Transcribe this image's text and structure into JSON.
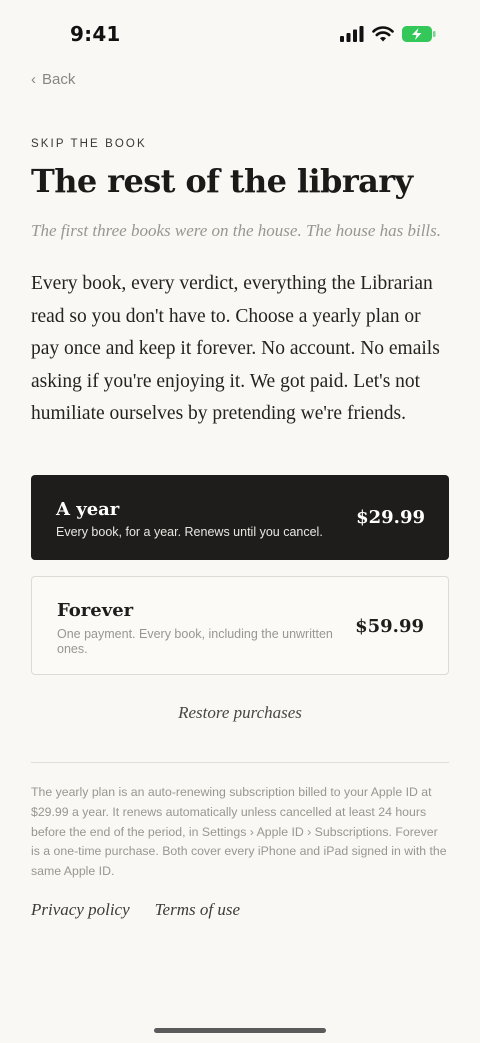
{
  "status_bar": {
    "time": "9:41",
    "icons": [
      "cellular-signal-icon",
      "wifi-icon",
      "battery-charging-icon"
    ],
    "battery_color": "#34c759"
  },
  "nav": {
    "back_label": "Back"
  },
  "header": {
    "eyebrow": "SKIP THE BOOK",
    "title": "The rest of the library",
    "subtitle": "The first three books were on the house. The house has bills."
  },
  "body": {
    "paragraph": "Every book, every verdict, everything the Librarian read so you don't have to. Choose a yearly plan or pay once and keep it forever. No account. No emails asking if you're enjoying it. We got paid. Let's not humiliate ourselves by pretending we're friends."
  },
  "plans": [
    {
      "name": "A year",
      "description": "Every book, for a year. Renews until you cancel.",
      "price": "$29.99",
      "selected": true
    },
    {
      "name": "Forever",
      "description": "One payment. Every book, including the unwritten ones.",
      "price": "$59.99",
      "selected": false
    }
  ],
  "actions": {
    "restore_label": "Restore purchases"
  },
  "legal": {
    "text": "The yearly plan is an auto-renewing subscription billed to your Apple ID at $29.99 a year. It renews automatically unless cancelled at least 24 hours before the end of the period, in Settings › Apple ID › Subscriptions. Forever is a one-time purchase. Both cover every iPhone and iPad signed in with the same Apple ID."
  },
  "footer": {
    "privacy_label": "Privacy policy",
    "terms_label": "Terms of use"
  },
  "colors": {
    "background": "#f9f8f4",
    "selected_plan": "#1f1d1b",
    "text_primary": "#1f1d1b",
    "text_muted": "#9a968f"
  }
}
